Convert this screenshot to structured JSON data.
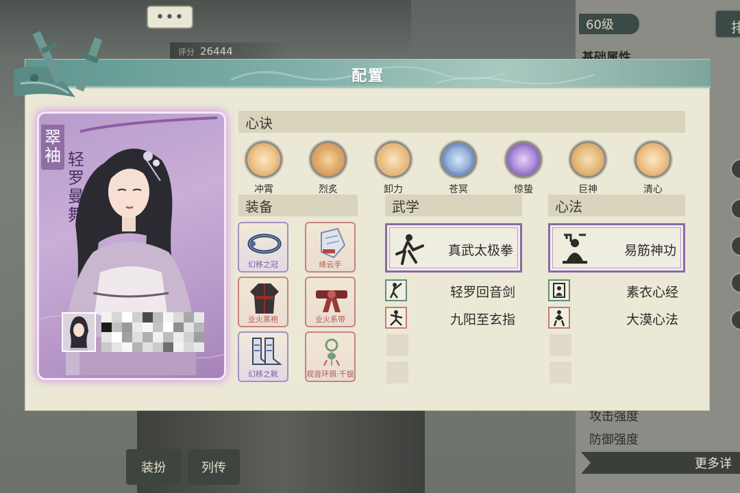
{
  "background": {
    "chat_icon": "•••",
    "score_label": "评分",
    "score_value": "26444",
    "level": "60级",
    "top_right_button": "排",
    "basic_attr_title": "基础属性",
    "stats": [
      "攻击强度",
      "防御强度"
    ],
    "more_button": "更多详",
    "bottom_tabs": [
      "装扮",
      "列传"
    ]
  },
  "dialog": {
    "title": "配置",
    "character": {
      "title": "翠袖",
      "name": "轻罗曼舞"
    },
    "xinjue": {
      "header": "心诀",
      "skills": [
        {
          "label": "冲霄",
          "color": "#e9b472",
          "core": "#f5d7a6",
          "icon": "flame-swirl-icon"
        },
        {
          "label": "烈炙",
          "color": "#d89c55",
          "core": "#f0c58a",
          "icon": "flame-burst-icon"
        },
        {
          "label": "卸力",
          "color": "#e2ae6b",
          "core": "#f6d9a9",
          "icon": "swirl-cloud-icon"
        },
        {
          "label": "苍冥",
          "color": "#5f7fb6",
          "core": "#a9c6ea",
          "icon": "water-wave-icon"
        },
        {
          "label": "惊蛰",
          "color": "#7a55b3",
          "core": "#c7a8ee",
          "icon": "thunder-icon"
        },
        {
          "label": "巨神",
          "color": "#d9a25f",
          "core": "#f2cf98",
          "icon": "golden-statue-icon"
        },
        {
          "label": "清心",
          "color": "#e4ae66",
          "core": "#f6d9a9",
          "icon": "lotus-icon"
        }
      ]
    },
    "equipment": {
      "header": "装备",
      "items": [
        {
          "label": "幻移之冠",
          "rarity": "purple",
          "icon": "headband-icon"
        },
        {
          "label": "绛云手",
          "rarity": "red",
          "icon": "gauntlet-icon"
        },
        {
          "label": "业火黑袍",
          "rarity": "red",
          "icon": "robe-icon"
        },
        {
          "label": "业火系带",
          "rarity": "red",
          "icon": "belt-icon"
        },
        {
          "label": "幻移之靴",
          "rarity": "purple",
          "icon": "boots-icon"
        },
        {
          "label": "观音环佩·千锟",
          "rarity": "red",
          "icon": "jade-pendant-icon"
        }
      ]
    },
    "wuxue": {
      "header": "武学",
      "main": "真武太极拳",
      "subs": [
        "轻罗回音剑",
        "九阳至玄指"
      ]
    },
    "xinfa": {
      "header": "心法",
      "main": "易筋神功",
      "subs": [
        "素衣心经",
        "大漠心法"
      ]
    }
  }
}
